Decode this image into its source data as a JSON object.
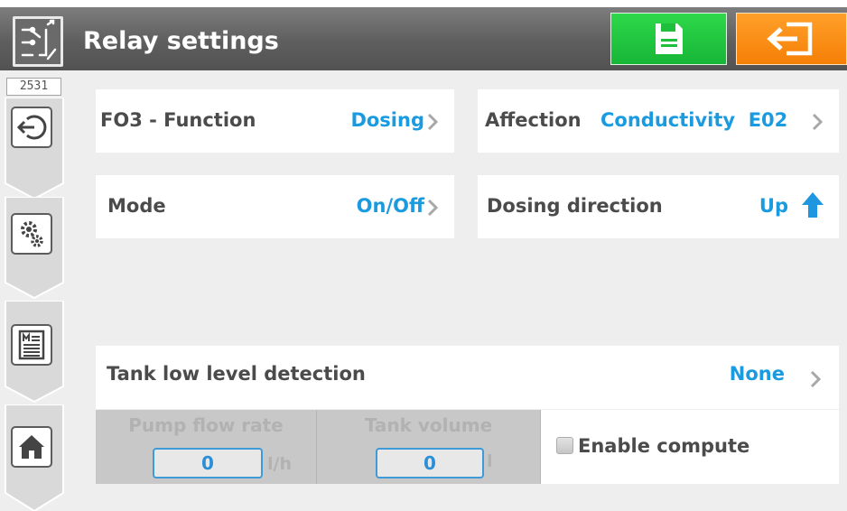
{
  "header": {
    "title": "Relay settings",
    "icon": "relay-switch-icon",
    "save_icon": "floppy-disk-icon",
    "exit_icon": "exit-door-icon"
  },
  "sidebar": {
    "device_id": "2531",
    "items": [
      {
        "icon": "input-login-icon"
      },
      {
        "icon": "gears-settings-icon"
      },
      {
        "icon": "menu-list-icon"
      },
      {
        "icon": "home-icon"
      }
    ]
  },
  "settings": {
    "function": {
      "label": "FO3 - Function",
      "value": "Dosing"
    },
    "affection": {
      "label": "Affection",
      "value": "Conductivity  E02"
    },
    "mode": {
      "label": "Mode",
      "value": "On/Off"
    },
    "dosing_direction": {
      "label": "Dosing direction",
      "value": "Up",
      "icon": "arrow-up-icon"
    },
    "tank_low_level": {
      "label": "Tank low level detection",
      "value": "None"
    }
  },
  "fields": {
    "pump_flow_rate": {
      "label": "Pump flow rate",
      "value": "0",
      "unit": "l/h"
    },
    "tank_volume": {
      "label": "Tank volume",
      "value": "0",
      "unit": "l"
    },
    "enable_compute": {
      "label": "Enable compute",
      "checked": false
    }
  },
  "colors": {
    "accent_value": "#1a9be0",
    "save_button": "#21c53f",
    "exit_button": "#f68a12",
    "header_bar": "#666666",
    "disabled_panel": "#c8c8c8"
  }
}
